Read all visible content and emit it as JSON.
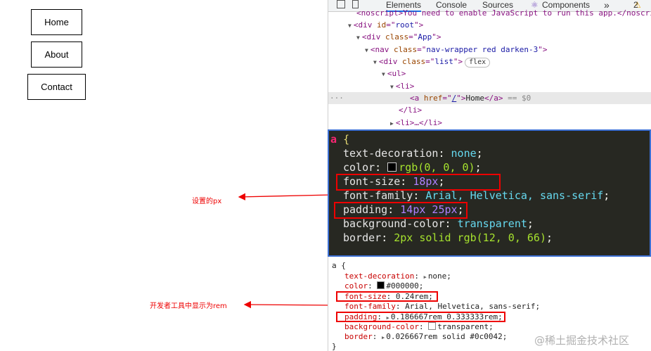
{
  "nav": {
    "items": [
      {
        "label": "Home"
      },
      {
        "label": "About"
      },
      {
        "label": "Contact"
      }
    ]
  },
  "annotations": {
    "px_note": "设置的px",
    "rem_note": "开发者工具中显示为rem",
    "color": "#e00000"
  },
  "devtools": {
    "tabs": [
      "Elements",
      "Console",
      "Sources",
      "Components"
    ],
    "more": "»",
    "warning_count": "2",
    "tree": {
      "noscript": "<noscript>You need to enable JavaScript to run this app.</noscript>",
      "div_root_id": "root",
      "div_app_class": "App",
      "nav_class": "nav-wrapper red darken-3",
      "div_list_class": "list",
      "flex_badge": "flex",
      "ul": "ul",
      "li": "li",
      "a_href": "/",
      "a_text": "Home",
      "eq_ref": "== $0",
      "li_close": "</li>",
      "li_collapsed": "<li>…</li>"
    }
  },
  "dark_css": {
    "selector": "a",
    "open": "{",
    "lines": [
      {
        "prop": "text-decoration",
        "value": "none"
      },
      {
        "prop": "color",
        "value": "rgb(0, 0, 0)"
      },
      {
        "prop": "font-size",
        "value": "18px"
      },
      {
        "prop": "font-family",
        "value": "Arial, Helvetica, sans-serif"
      },
      {
        "prop": "padding",
        "value": "14px 25px"
      },
      {
        "prop": "background-color",
        "value": "transparent"
      },
      {
        "prop": "border",
        "value": "2px solid rgb(12, 0, 66)"
      }
    ],
    "colors": {
      "swatch_black": "#000000",
      "swatch_border": "#0c0042"
    }
  },
  "light_css": {
    "selector": "a {",
    "close": "}",
    "lines": [
      {
        "prop": "text-decoration",
        "value": "none;"
      },
      {
        "prop": "color",
        "value": "#000000;"
      },
      {
        "prop": "font-size",
        "value": "0.24rem;"
      },
      {
        "prop": "font-family",
        "value": "Arial, Helvetica, sans-serif;"
      },
      {
        "prop": "padding",
        "value": "0.186667rem 0.333333rem;"
      },
      {
        "prop": "background-color",
        "value": "transparent;"
      },
      {
        "prop": "border",
        "value": "0.026667rem solid #0c0042;"
      }
    ]
  },
  "watermark": "@稀土掘金技术社区"
}
